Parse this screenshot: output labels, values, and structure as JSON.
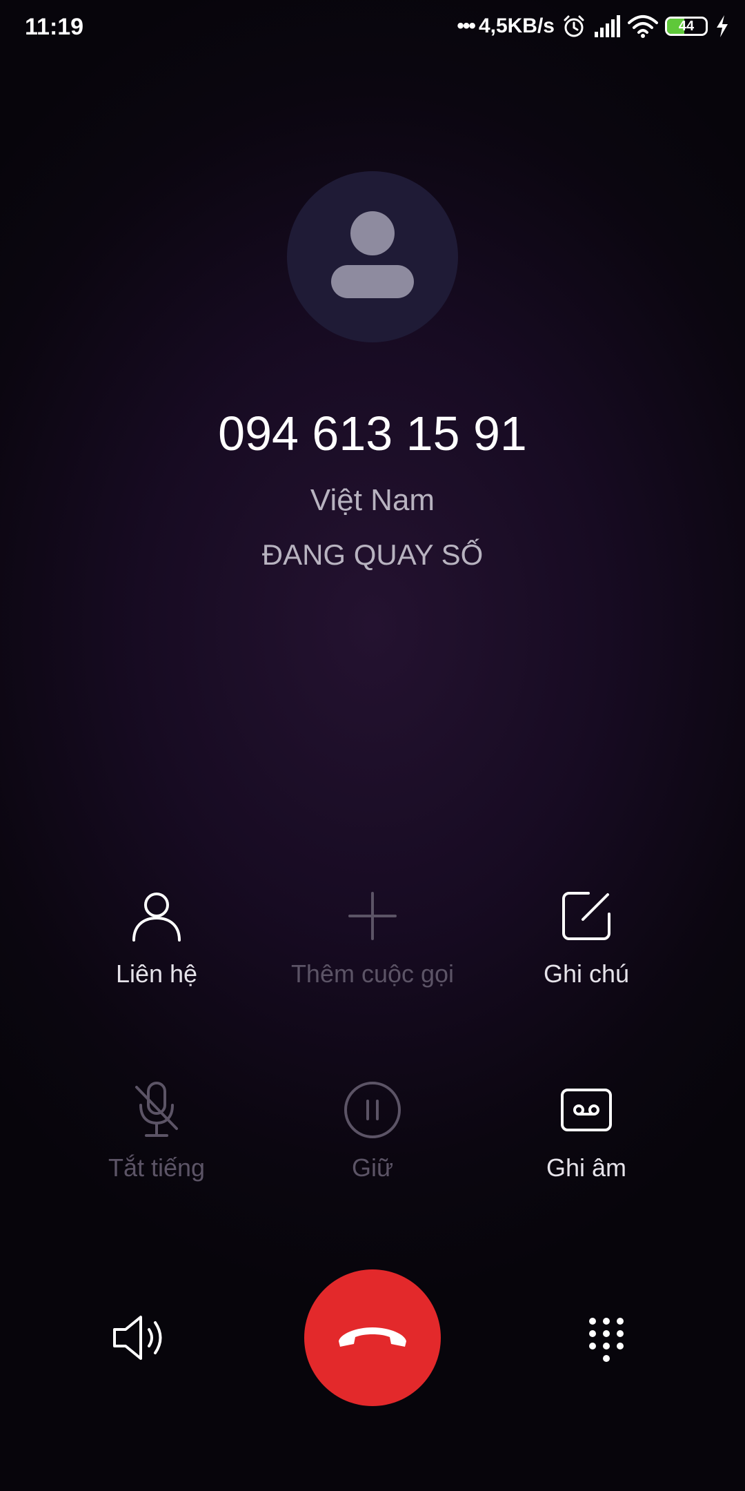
{
  "status_bar": {
    "time": "11:19",
    "network_speed": "4,5KB/s",
    "battery_level": "44",
    "battery_fraction": 0.44,
    "icons": [
      "more-dots-icon",
      "alarm-icon",
      "signal-icon",
      "wifi-icon",
      "battery-icon",
      "charging-icon"
    ]
  },
  "call": {
    "number": "094 613 15 91",
    "location": "Việt Nam",
    "status": "ĐANG QUAY SỐ"
  },
  "actions": [
    {
      "label": "Liên hệ",
      "icon": "contact-icon",
      "enabled": true
    },
    {
      "label": "Thêm cuộc gọi",
      "icon": "add-call-icon",
      "enabled": false
    },
    {
      "label": "Ghi chú",
      "icon": "note-icon",
      "enabled": true
    },
    {
      "label": "Tắt tiếng",
      "icon": "mute-icon",
      "enabled": false
    },
    {
      "label": "Giữ",
      "icon": "hold-icon",
      "enabled": false
    },
    {
      "label": "Ghi âm",
      "icon": "record-icon",
      "enabled": true
    }
  ],
  "bottom_bar": {
    "left_icon": "speaker-icon",
    "center_icon": "end-call-icon",
    "right_icon": "dialpad-icon"
  },
  "colors": {
    "end_call": "#e3292b",
    "battery_fill": "#5fc83a",
    "avatar_bg": "#1f1b36"
  }
}
